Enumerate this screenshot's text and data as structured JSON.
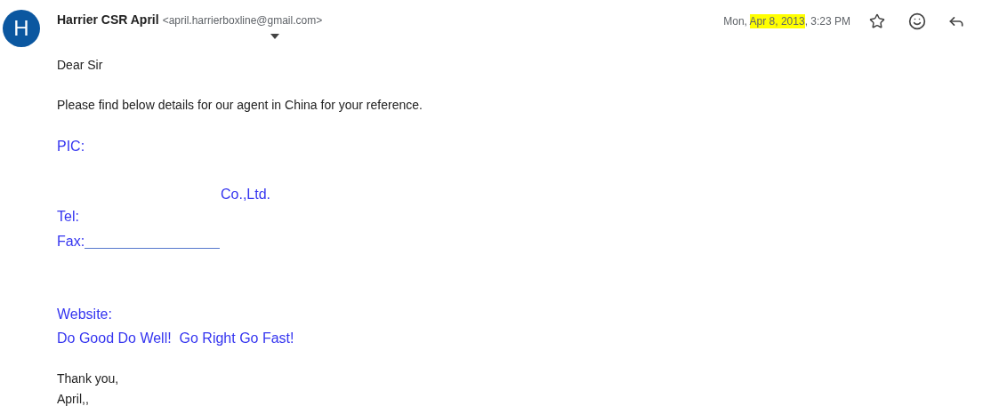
{
  "sender": {
    "avatar_letter": "H",
    "name": "Harrier CSR April",
    "email": "<april.harrierboxline@gmail.com>"
  },
  "date": {
    "prefix": "Mon, ",
    "highlighted": "Apr 8, 2013",
    "suffix": ", 3:23 PM"
  },
  "body": [
    {
      "kind": "plain",
      "text": "Dear Sir"
    },
    {
      "kind": "plain",
      "text": "Please find below details for our agent in China for your reference."
    },
    {
      "kind": "blue",
      "text": "PIC:"
    },
    {
      "kind": "blue-indent",
      "text": "Co.,Ltd."
    },
    {
      "kind": "blue",
      "text": "Tel:"
    },
    {
      "kind": "blue-line",
      "text": "Fax:"
    },
    {
      "kind": "blue",
      "text": "Website:"
    },
    {
      "kind": "blue",
      "text": "Do Good Do Well!  Go Right Go Fast!"
    },
    {
      "kind": "plain",
      "text": "Thank you,"
    },
    {
      "kind": "plain",
      "text": "April,,"
    }
  ]
}
